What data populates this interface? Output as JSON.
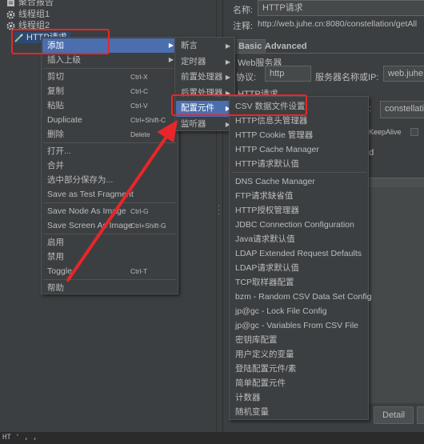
{
  "tree": {
    "items": [
      {
        "label": "聚合报告"
      },
      {
        "label": "线程组1"
      },
      {
        "label": "线程组2"
      },
      {
        "label": "HTTP请求"
      }
    ]
  },
  "right_panel": {
    "name_label": "名称:",
    "name_value": "HTTP请求",
    "comment_label": "注释:",
    "comment_value": "http://web.juhe.cn:8080/constellation/getAll",
    "tabs": [
      "Basic",
      "Advanced"
    ],
    "web_server_title": "Web服务器",
    "protocol_label": "协议:",
    "protocol_value": "http",
    "server_label": "服务器名称或IP:",
    "server_value": "web.juhe.c",
    "http_request_title": "HTTP请求",
    "path_label": ":",
    "path_value": "constellation",
    "keepalive_label": "KeepAlive",
    "upload_fragment": "ad",
    "detail_button": "Detail"
  },
  "context_menu": {
    "items": [
      {
        "label": "添加",
        "shortcut": "",
        "submenu": true,
        "selected": true
      },
      {
        "label": "插入上级",
        "shortcut": "",
        "submenu": true
      },
      {
        "separator": true
      },
      {
        "label": "剪切",
        "shortcut": "Ctrl-X"
      },
      {
        "label": "复制",
        "shortcut": "Ctrl-C"
      },
      {
        "label": "粘贴",
        "shortcut": "Ctrl-V"
      },
      {
        "label": "Duplicate",
        "shortcut": "Ctrl+Shift-C"
      },
      {
        "label": "删除",
        "shortcut": "Delete"
      },
      {
        "separator": true
      },
      {
        "label": "打开..."
      },
      {
        "label": "合并"
      },
      {
        "label": "选中部分保存为..."
      },
      {
        "label": "Save as Test Fragment"
      },
      {
        "separator": true
      },
      {
        "label": "Save Node As Image",
        "shortcut": "Ctrl-G"
      },
      {
        "label": "Save Screen As Image",
        "shortcut": "Ctrl+Shift-G"
      },
      {
        "separator": true
      },
      {
        "label": "启用"
      },
      {
        "label": "禁用"
      },
      {
        "label": "Toggle",
        "shortcut": "Ctrl-T"
      },
      {
        "separator": true
      },
      {
        "label": "帮助"
      }
    ]
  },
  "add_submenu": {
    "items": [
      {
        "label": "断言"
      },
      {
        "label": "定时器"
      },
      {
        "label": "前置处理器"
      },
      {
        "label": "后置处理器"
      },
      {
        "label": "配置元件",
        "selected": true
      },
      {
        "label": "监听器"
      }
    ]
  },
  "config_submenu": {
    "items": [
      {
        "label": "CSV 数据文件设置"
      },
      {
        "label": "HTTP信息头管理器"
      },
      {
        "label": "HTTP Cookie 管理器"
      },
      {
        "label": "HTTP Cache Manager"
      },
      {
        "label": "HTTP请求默认值"
      },
      {
        "separator": true
      },
      {
        "label": "DNS Cache Manager"
      },
      {
        "label": "FTP请求缺省值"
      },
      {
        "label": "HTTP授权管理器"
      },
      {
        "label": "JDBC Connection Configuration"
      },
      {
        "label": "Java请求默认值"
      },
      {
        "label": "LDAP Extended Request Defaults"
      },
      {
        "label": "LDAP请求默认值"
      },
      {
        "label": "TCP取样器配置"
      },
      {
        "label": "bzm - Random CSV Data Set Config"
      },
      {
        "label": "jp@gc - Lock File Config"
      },
      {
        "label": "jp@gc - Variables From CSV File"
      },
      {
        "label": "密钥库配置"
      },
      {
        "label": "用户定义的变量"
      },
      {
        "label": "登陆配置元件/素"
      },
      {
        "label": "简单配置元件"
      },
      {
        "label": "计数器"
      },
      {
        "label": "随机变量"
      }
    ]
  },
  "bottom_strip": {
    "text": "HT ' , ,"
  },
  "colors": {
    "background": "#3c3f41",
    "menu_selected": "#4b6eaf",
    "annotation_red": "#e8262a",
    "text": "#bbbbbb"
  },
  "icons": {
    "tree_report": "report-icon",
    "tree_thread_group": "gear-icon",
    "tree_sampler": "pencil-icon",
    "submenu_arrow": "triangle-right-icon"
  }
}
